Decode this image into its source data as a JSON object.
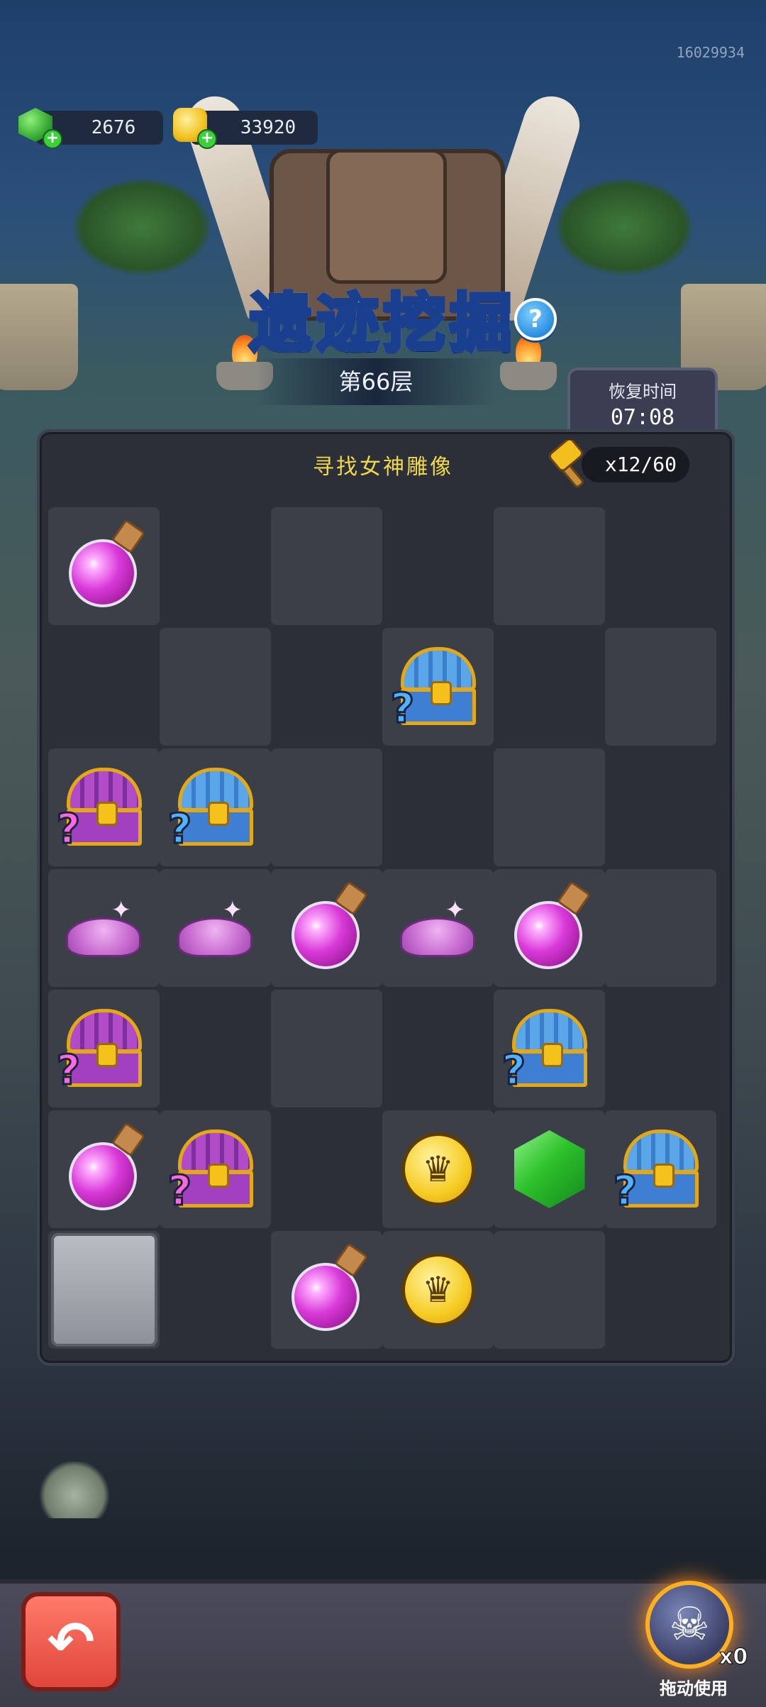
{
  "player_id": "16029934",
  "currency": {
    "gems": "2676",
    "crowns": "33920"
  },
  "title": "遗迹挖掘",
  "floor_label": "第66层",
  "recover": {
    "label": "恢复时间",
    "time": "07:08"
  },
  "objective": "寻找女神雕像",
  "hammers": "x12/60",
  "board": {
    "columns": 6,
    "rows": 7,
    "tiles": [
      [
        "potion",
        "dug",
        "covered",
        "dug",
        "covered",
        "dug"
      ],
      [
        "dug",
        "covered",
        "dug",
        "chest-blue",
        "dug",
        "covered"
      ],
      [
        "chest-purple",
        "chest-blue",
        "covered",
        "dug",
        "covered",
        "dug"
      ],
      [
        "dust",
        "dust",
        "potion",
        "dust",
        "potion",
        "covered"
      ],
      [
        "chest-purple",
        "dug",
        "covered",
        "dug",
        "chest-blue",
        "dug"
      ],
      [
        "potion",
        "chest-purple",
        "dug",
        "crown-coin",
        "emerald",
        "chest-blue"
      ],
      [
        "stone",
        "dug",
        "potion",
        "crown-coin",
        "covered",
        "dug"
      ]
    ]
  },
  "bomb": {
    "count": "x0",
    "label": "拖动使用"
  },
  "colors": {
    "objective": "#f3d84a",
    "board": "#2b2f38",
    "back_button": "#e0453a"
  }
}
